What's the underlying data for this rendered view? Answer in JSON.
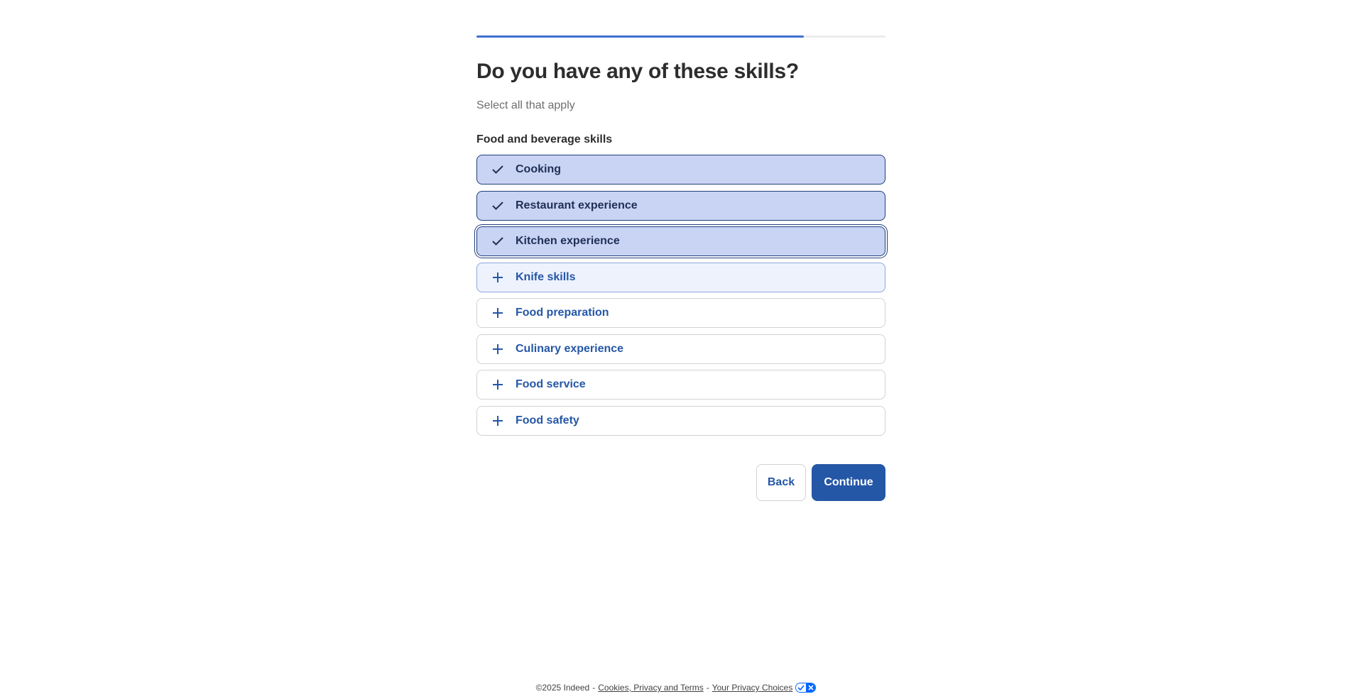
{
  "progress": {
    "fraction": 0.8
  },
  "page": {
    "title": "Do you have any of these skills?",
    "subtitle": "Select all that apply",
    "group_label": "Food and beverage skills"
  },
  "options": [
    {
      "label": "Cooking",
      "selected": true,
      "icon": "check-icon"
    },
    {
      "label": "Restaurant experience",
      "selected": true,
      "icon": "check-icon"
    },
    {
      "label": "Kitchen experience",
      "selected": true,
      "icon": "check-icon",
      "focused": true
    },
    {
      "label": "Knife skills",
      "selected": false,
      "icon": "plus-icon",
      "hover": true
    },
    {
      "label": "Food preparation",
      "selected": false,
      "icon": "plus-icon"
    },
    {
      "label": "Culinary experience",
      "selected": false,
      "icon": "plus-icon"
    },
    {
      "label": "Food service",
      "selected": false,
      "icon": "plus-icon"
    },
    {
      "label": "Food safety",
      "selected": false,
      "icon": "plus-icon"
    }
  ],
  "buttons": {
    "back_label": "Back",
    "continue_label": "Continue"
  },
  "footer": {
    "copyright": "©2025 Indeed",
    "dash": "-",
    "cookies_link": "Cookies, Privacy and Terms",
    "privacy_link": "Your Privacy Choices",
    "privacy_icon": "privacy-choices-icon"
  },
  "colors": {
    "accent": "#2557a7",
    "progress": "#3f6fd1",
    "selected_bg": "#c9d3f4",
    "hover_bg": "#eef2fd"
  }
}
